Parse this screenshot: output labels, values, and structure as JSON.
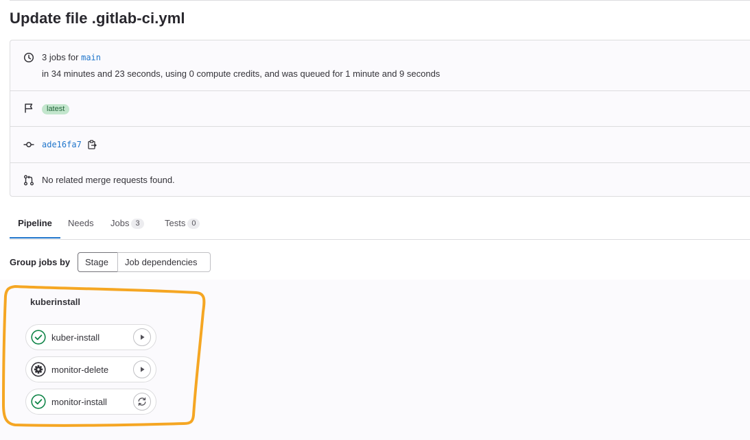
{
  "page": {
    "title": "Update file .gitlab-ci.yml"
  },
  "summary": {
    "jobs_prefix": "3 jobs for",
    "branch": "main",
    "duration_text": "in 34 minutes and 23 seconds, using 0 compute credits, and was queued for 1 minute and 9 seconds",
    "badge": "latest",
    "commit_sha": "ade16fa7",
    "merge_requests_text": "No related merge requests found.",
    "icons": [
      "clock-icon",
      "flag-icon",
      "commit-icon",
      "merge-request-icon",
      "copy-icon"
    ]
  },
  "tabs": [
    {
      "label": "Pipeline",
      "count": null,
      "active": true
    },
    {
      "label": "Needs",
      "count": null,
      "active": false
    },
    {
      "label": "Jobs",
      "count": "3",
      "active": false
    },
    {
      "label": "Tests",
      "count": "0",
      "active": false
    }
  ],
  "grouping": {
    "label": "Group jobs by",
    "options": [
      "Stage",
      "Job dependencies"
    ],
    "selected": "Stage"
  },
  "stage": {
    "name": "kuberinstall",
    "jobs": [
      {
        "name": "kuber-install",
        "status": "success",
        "status_icon": "check-circle-icon",
        "action": "play",
        "action_icon": "play-icon"
      },
      {
        "name": "monitor-delete",
        "status": "manual",
        "status_icon": "gear-icon",
        "action": "play",
        "action_icon": "play-icon"
      },
      {
        "name": "monitor-install",
        "status": "success",
        "status_icon": "check-circle-icon",
        "action": "retry",
        "action_icon": "retry-icon"
      }
    ]
  },
  "colors": {
    "success": "#108548",
    "manual": "#333238",
    "link": "#1f75cb",
    "badge_bg": "#c3e6cd",
    "badge_text": "#24663b",
    "highlight": "#f5a623"
  }
}
